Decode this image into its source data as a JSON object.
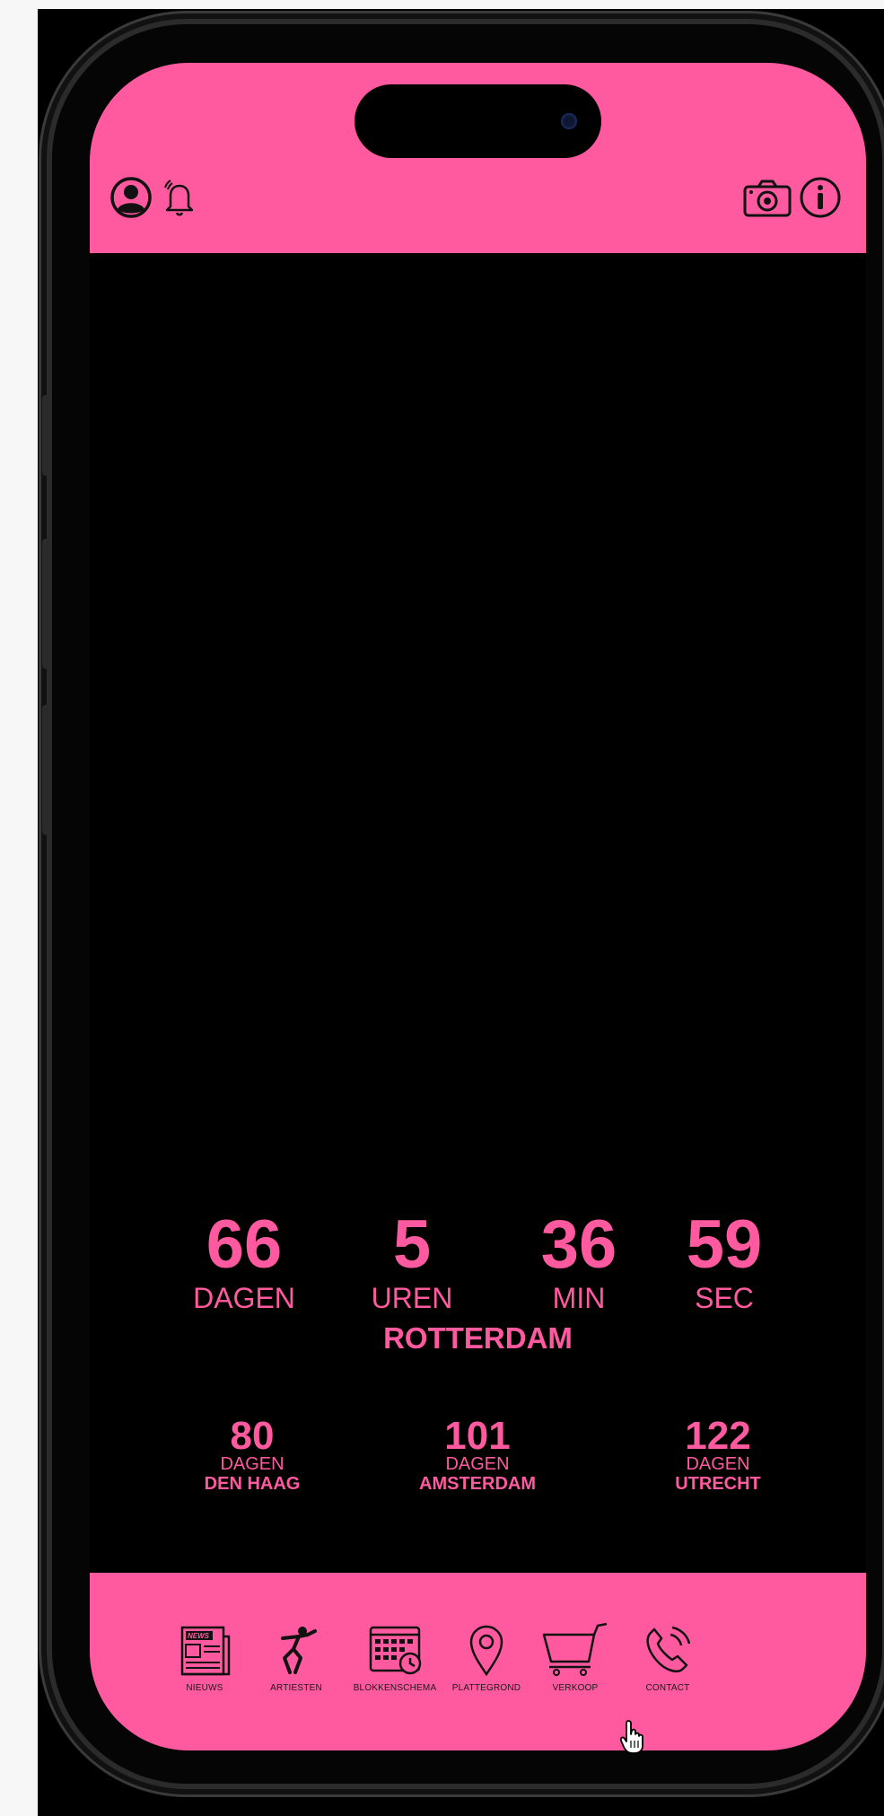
{
  "header": {
    "left_icons": [
      "profile-icon",
      "bell-icon"
    ],
    "right_icons": [
      "camera-icon",
      "info-icon"
    ],
    "color": "#ff5a9f"
  },
  "countdown_main": {
    "days": "66",
    "days_label": "DAGEN",
    "hours": "5",
    "hours_label": "UREN",
    "minutes": "36",
    "minutes_label": "MIN",
    "seconds": "59",
    "seconds_label": "SEC",
    "city": "ROTTERDAM"
  },
  "countdown_other": [
    {
      "days": "80",
      "label": "DAGEN",
      "city": "DEN HAAG"
    },
    {
      "days": "101",
      "label": "DAGEN",
      "city": "AMSTERDAM"
    },
    {
      "days": "122",
      "label": "DAGEN",
      "city": "UTRECHT"
    }
  ],
  "tabs": [
    {
      "label": "NIEUWS",
      "icon": "news-icon"
    },
    {
      "label": "ARTIESTEN",
      "icon": "dancer-icon"
    },
    {
      "label": "BLOKKENSCHEMA",
      "icon": "calendar-icon"
    },
    {
      "label": "PLATTEGROND",
      "icon": "map-pin-icon"
    },
    {
      "label": "VERKOOP",
      "icon": "cart-icon"
    },
    {
      "label": "CONTACT",
      "icon": "phone-icon"
    }
  ],
  "colors": {
    "accent": "#ff5a9f",
    "background": "#000000"
  }
}
